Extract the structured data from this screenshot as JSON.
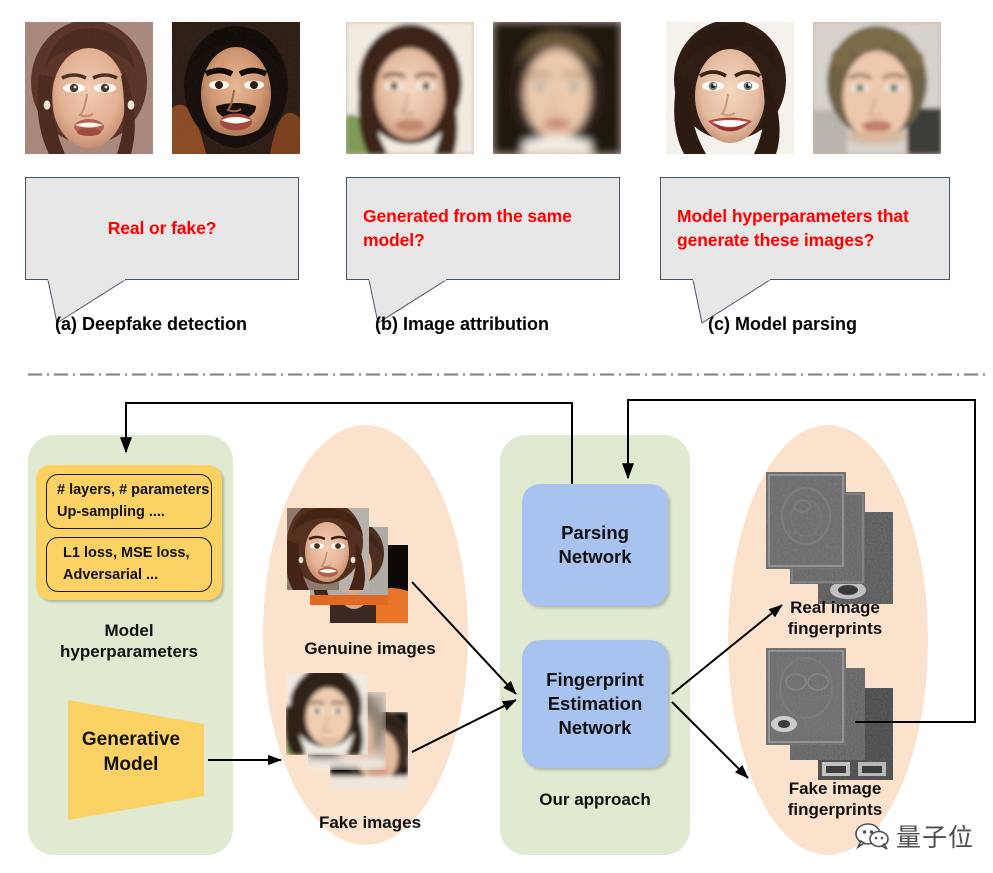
{
  "top_section": {
    "panels": [
      {
        "id": "deepfake-detection",
        "caption": "(a) Deepfake detection",
        "question": "Real or fake?",
        "faces": [
          "real-woman-face",
          "real-bearded-man-face"
        ]
      },
      {
        "id": "image-attribution",
        "caption": "(b) Image attribution",
        "question": "Generated from the same model?",
        "faces": [
          "generated-woman-face",
          "generated-blond-man-face"
        ]
      },
      {
        "id": "model-parsing",
        "caption": "(c) Model parsing",
        "question": "Model hyperparameters that generate these images?",
        "faces": [
          "real-smiling-woman-face",
          "generated-curly-man-face"
        ]
      }
    ]
  },
  "diagram": {
    "left_panel": {
      "hyperparam_boxes": [
        {
          "lines": [
            "# layers, # parameters",
            "Up-sampling ...."
          ]
        },
        {
          "lines": [
            "L1 loss,  MSE loss,",
            "Adversarial ..."
          ]
        }
      ],
      "hyperparam_label": "Model\nhyperparameters",
      "generative_model_label": "Generative\nModel"
    },
    "images_ellipse": {
      "genuine_label": "Genuine images",
      "fake_label": "Fake images"
    },
    "approach_panel": {
      "parsing_network_label": "Parsing\nNetwork",
      "fingerprint_network_label": "Fingerprint\nEstimation\nNetwork",
      "panel_label": "Our approach"
    },
    "fingerprints_ellipse": {
      "real_label": "Real image\nfingerprints",
      "fake_label": "Fake image\nfingerprints"
    }
  },
  "watermark": {
    "text": "量子位",
    "icon": "wechat-bubble-icon"
  },
  "colors": {
    "question_text": "#fe0000",
    "bubble_fill": "#e7e7e7",
    "bubble_border": "#44546a",
    "green_panel": "#dfead1",
    "peach_ellipse": "#fbe2cd",
    "yellow_card": "#fcd265",
    "blue_box": "#a8c3f0",
    "arrow": "#000000"
  }
}
